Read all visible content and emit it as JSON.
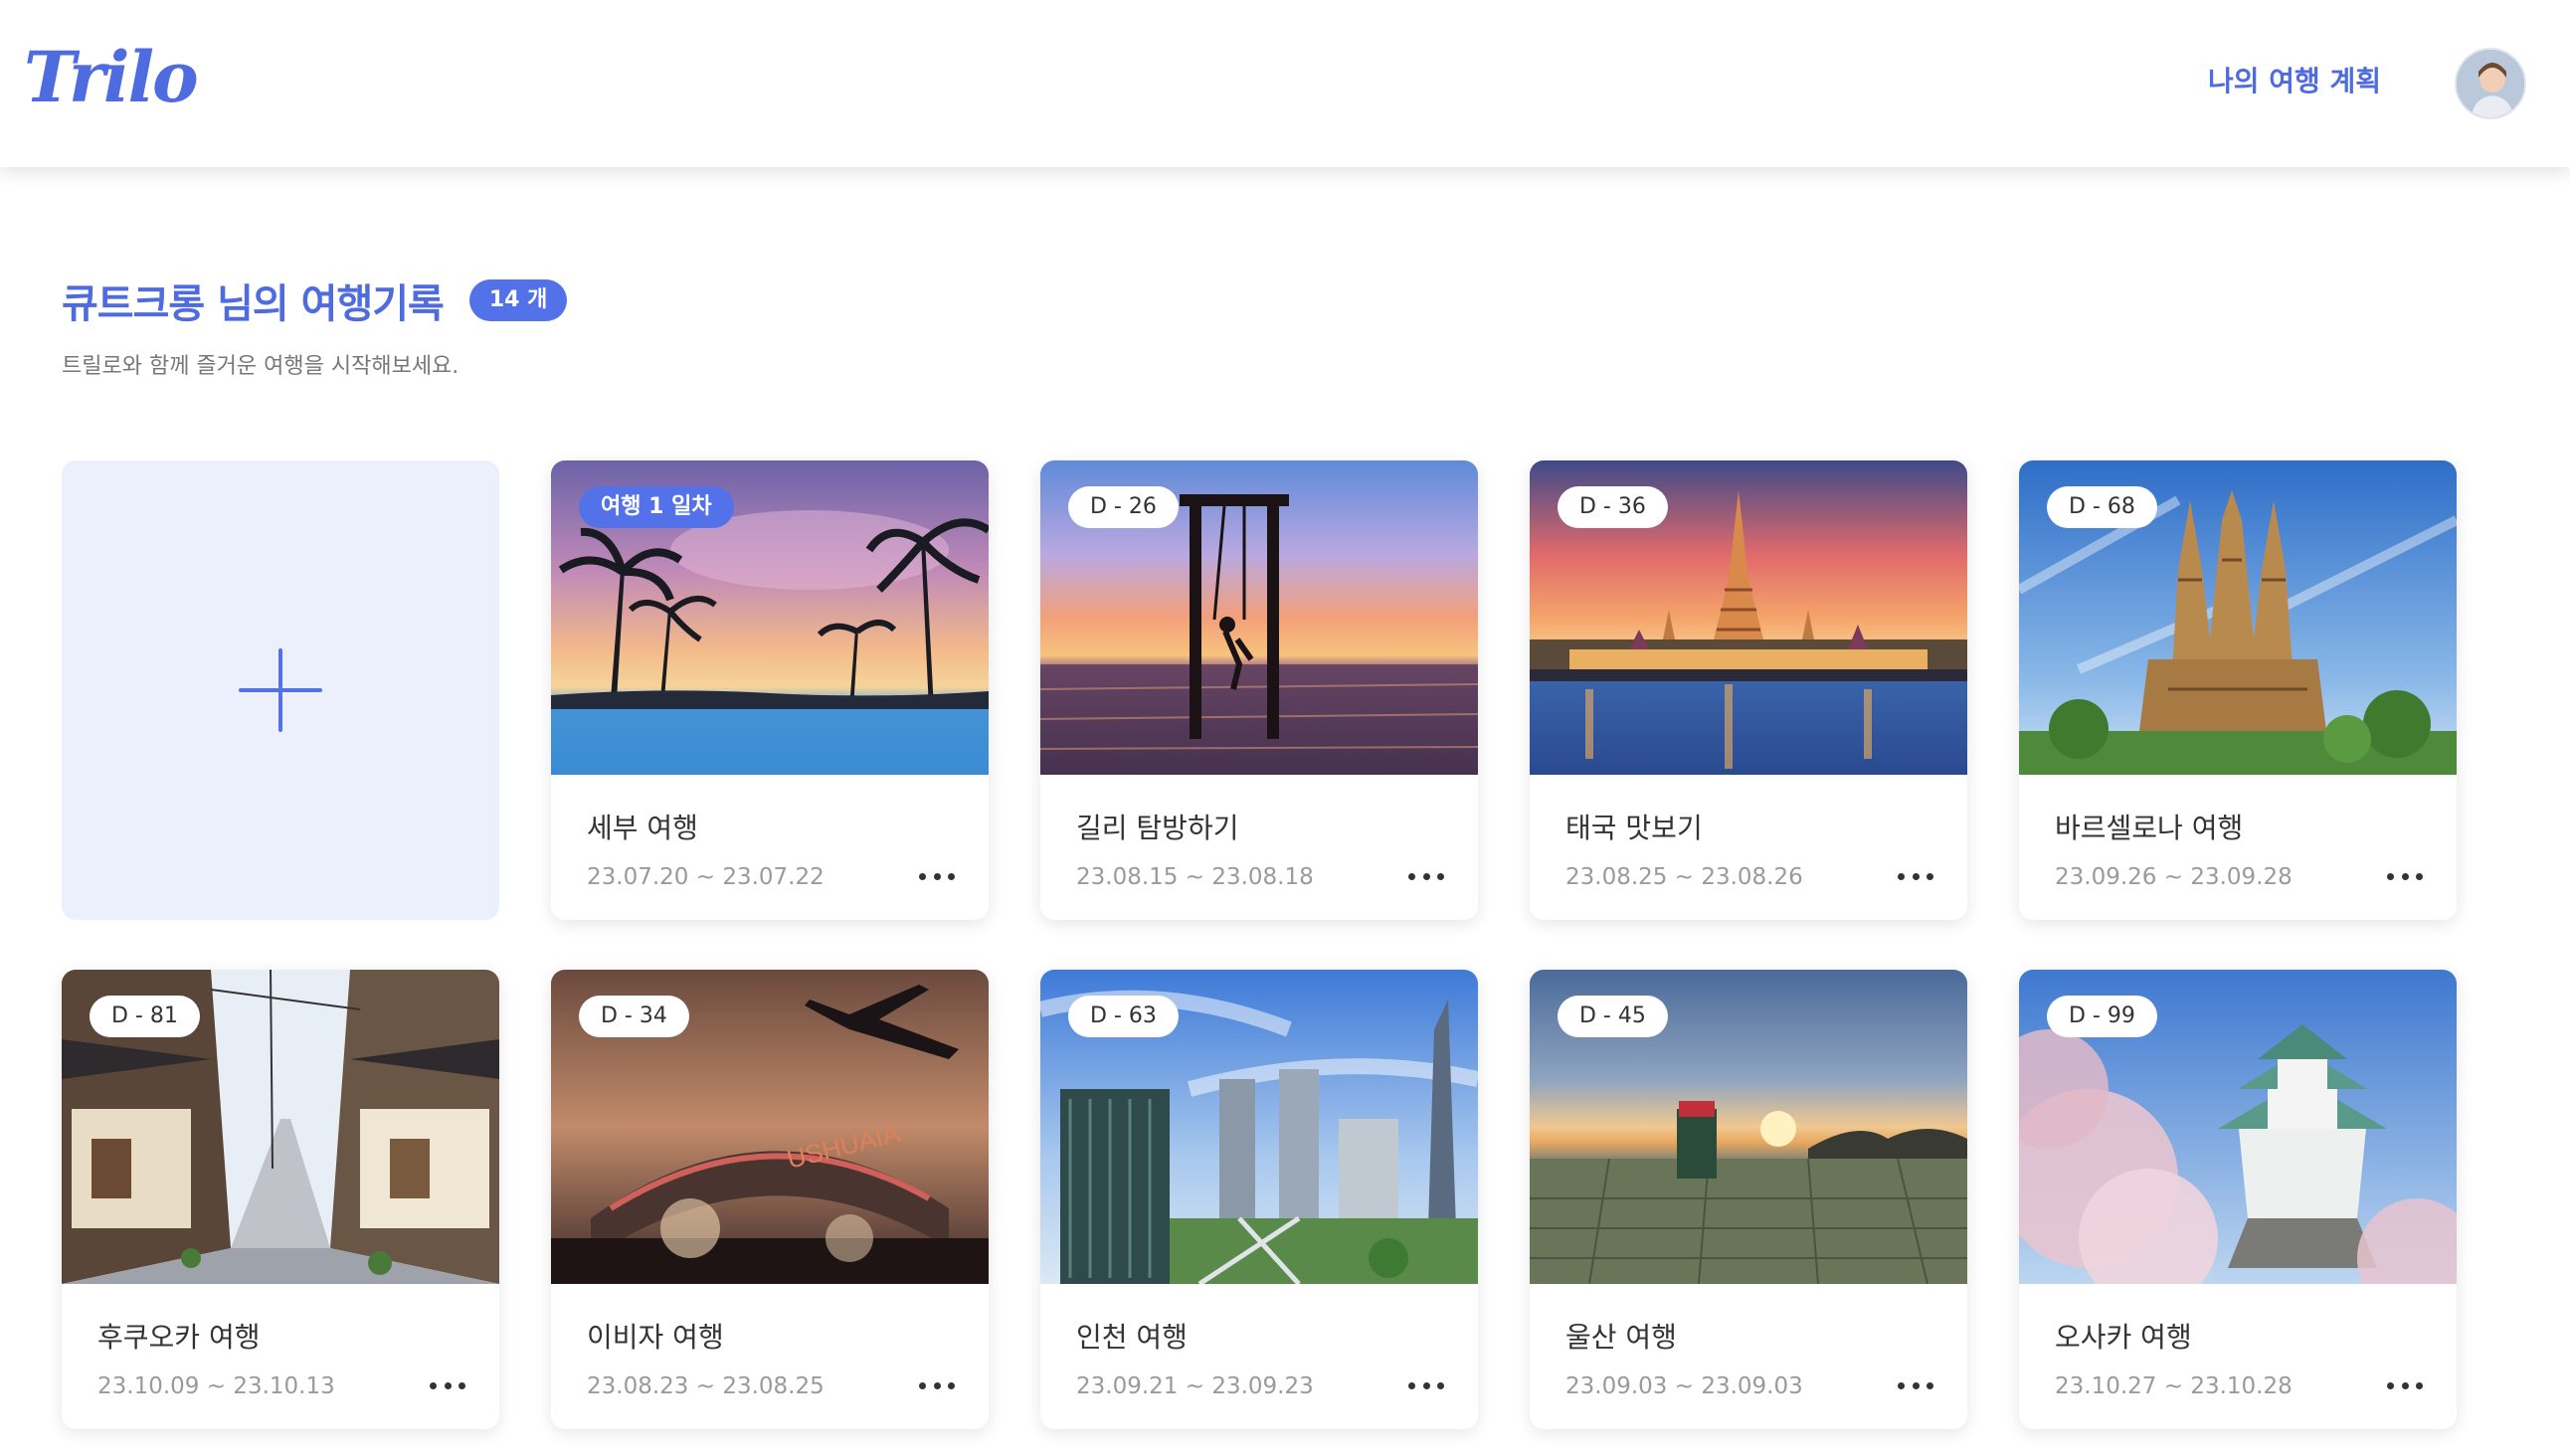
{
  "header": {
    "logo": "Trilo",
    "nav_link": "나의 여행 계획",
    "avatar_icon": "user-avatar"
  },
  "page": {
    "title": "큐트크롱 님의 여행기록",
    "count_badge": "14 개",
    "subtitle": "트릴로와 함께 즐거운 여행을 시작해보세요."
  },
  "add_card": {
    "icon": "plus-icon"
  },
  "trips": [
    {
      "badge": "여행 1 일차",
      "active": true,
      "title": "세부 여행",
      "dates": "23.07.20 ~ 23.07.22",
      "scene": "tropical-sunset"
    },
    {
      "badge": "D - 26",
      "active": false,
      "title": "길리 탐방하기",
      "dates": "23.08.15 ~ 23.08.18",
      "scene": "sea-swing"
    },
    {
      "badge": "D - 36",
      "active": false,
      "title": "태국 맛보기",
      "dates": "23.08.25 ~ 23.08.26",
      "scene": "temple-river"
    },
    {
      "badge": "D - 68",
      "active": false,
      "title": "바르셀로나 여행",
      "dates": "23.09.26 ~ 23.09.28",
      "scene": "cathedral"
    },
    {
      "badge": "D - 81",
      "active": false,
      "title": "후쿠오카 여행",
      "dates": "23.10.09 ~ 23.10.13",
      "scene": "old-street"
    },
    {
      "badge": "D - 34",
      "active": false,
      "title": "이비자 여행",
      "dates": "23.08.23 ~ 23.08.25",
      "scene": "festival-plane"
    },
    {
      "badge": "D - 63",
      "active": false,
      "title": "인천 여행",
      "dates": "23.09.21 ~ 23.09.23",
      "scene": "city-towers"
    },
    {
      "badge": "D - 45",
      "active": false,
      "title": "울산 여행",
      "dates": "23.09.03 ~ 23.09.03",
      "scene": "coast-sunrise"
    },
    {
      "badge": "D - 99",
      "active": false,
      "title": "오사카 여행",
      "dates": "23.10.27 ~ 23.10.28",
      "scene": "castle-blossom"
    }
  ],
  "colors": {
    "accent": "#5372ea",
    "accent_text": "#4e6be0",
    "add_card_bg": "#ecf0fd"
  }
}
